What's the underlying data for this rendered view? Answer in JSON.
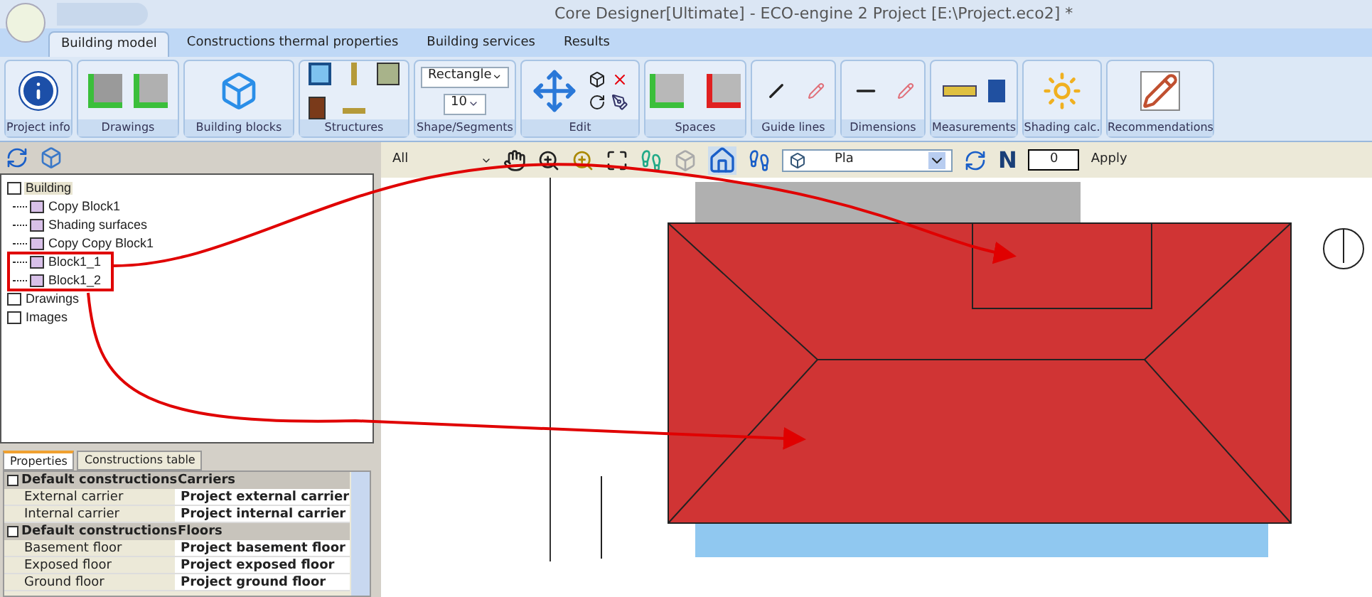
{
  "window": {
    "title": "Core Designer[Ultimate] - ECO-engine 2 Project [E:\\Project.eco2] *"
  },
  "ribbon_tabs": [
    {
      "label": "Building model",
      "selected": true
    },
    {
      "label": "Constructions thermal properties",
      "selected": false
    },
    {
      "label": "Building services",
      "selected": false
    },
    {
      "label": "Results",
      "selected": false
    }
  ],
  "ribbon_groups": [
    {
      "label": "Project info"
    },
    {
      "label": "Drawings"
    },
    {
      "label": "Building blocks"
    },
    {
      "label": "Structures"
    },
    {
      "label": "Shape/Segments",
      "shape": "Rectangle",
      "segments": "10"
    },
    {
      "label": "Edit"
    },
    {
      "label": "Spaces"
    },
    {
      "label": "Guide lines"
    },
    {
      "label": "Dimensions"
    },
    {
      "label": "Measurements"
    },
    {
      "label": "Shading calc."
    },
    {
      "label": "Recommendations"
    }
  ],
  "tree": [
    {
      "label": "Building",
      "selected": true,
      "children": [
        {
          "label": "Copy Block1",
          "selected": false
        },
        {
          "label": "Shading surfaces",
          "selected": false
        },
        {
          "label": "Copy Copy Block1",
          "selected": false
        },
        {
          "label": "Block1_1",
          "selected": false
        },
        {
          "label": "Block1_2",
          "selected": false
        }
      ]
    },
    {
      "label": "Drawings",
      "selected": false
    },
    {
      "label": "Images",
      "selected": false
    }
  ],
  "property_tabs": [
    {
      "label": "Properties",
      "selected": true
    },
    {
      "label": "Constructions table",
      "selected": false
    }
  ],
  "properties": [
    {
      "kind": "section",
      "name": "Default constructions",
      "value": "Carriers"
    },
    {
      "kind": "row",
      "name": "External carrier",
      "value": "Project external carrier"
    },
    {
      "kind": "row",
      "name": "Internal carrier",
      "value": "Project internal carrier"
    },
    {
      "kind": "section",
      "name": "Default constructions",
      "value": "Floors"
    },
    {
      "kind": "row",
      "name": "Basement floor",
      "value": "Project basement floor"
    },
    {
      "kind": "row",
      "name": "Exposed floor",
      "value": "Project exposed floor"
    },
    {
      "kind": "row",
      "name": "Ground floor",
      "value": "Project ground floor"
    }
  ],
  "canvas_toolbar": {
    "select_filter": "All",
    "view": "Pla",
    "north_label": "N",
    "north": "0",
    "apply": "Apply"
  }
}
